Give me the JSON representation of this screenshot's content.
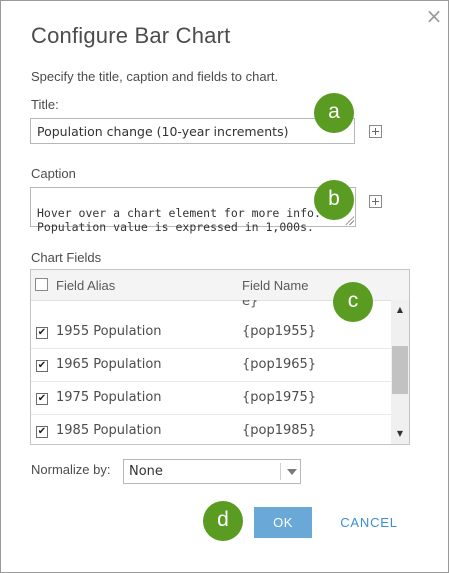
{
  "dialog": {
    "title": "Configure Bar Chart",
    "instructions": "Specify the title, caption and fields to chart.",
    "close_glyph": "×"
  },
  "title_field": {
    "label": "Title:",
    "value": "Population change (10-year increments)"
  },
  "caption_field": {
    "label": "Caption",
    "value": "Hover over a chart element for more info.\nPopulation value is expressed in 1,000s."
  },
  "chart_fields": {
    "label": "Chart Fields",
    "columns": {
      "alias": "Field Alias",
      "name": "Field Name"
    },
    "partial_row_name": "e}",
    "rows": [
      {
        "alias": "1955 Population",
        "name": "{pop1955}",
        "checked": true
      },
      {
        "alias": "1965 Population",
        "name": "{pop1965}",
        "checked": true
      },
      {
        "alias": "1975 Population",
        "name": "{pop1975}",
        "checked": true
      },
      {
        "alias": "1985 Population",
        "name": "{pop1985}",
        "checked": true
      }
    ],
    "check_glyph": "✔",
    "scroll_up_glyph": "▲",
    "scroll_down_glyph": "▼"
  },
  "normalize": {
    "label": "Normalize by:",
    "selected": "None"
  },
  "buttons": {
    "ok": "OK",
    "cancel": "CANCEL"
  },
  "callouts": [
    "a",
    "b",
    "c",
    "d"
  ],
  "colors": {
    "callout": "#5a9b22",
    "ok_button": "#6aa8d8",
    "cancel_link": "#3a8fd4"
  },
  "icons": [
    "close-icon",
    "plus-icon",
    "checkbox-icon",
    "chevron-down-icon"
  ]
}
